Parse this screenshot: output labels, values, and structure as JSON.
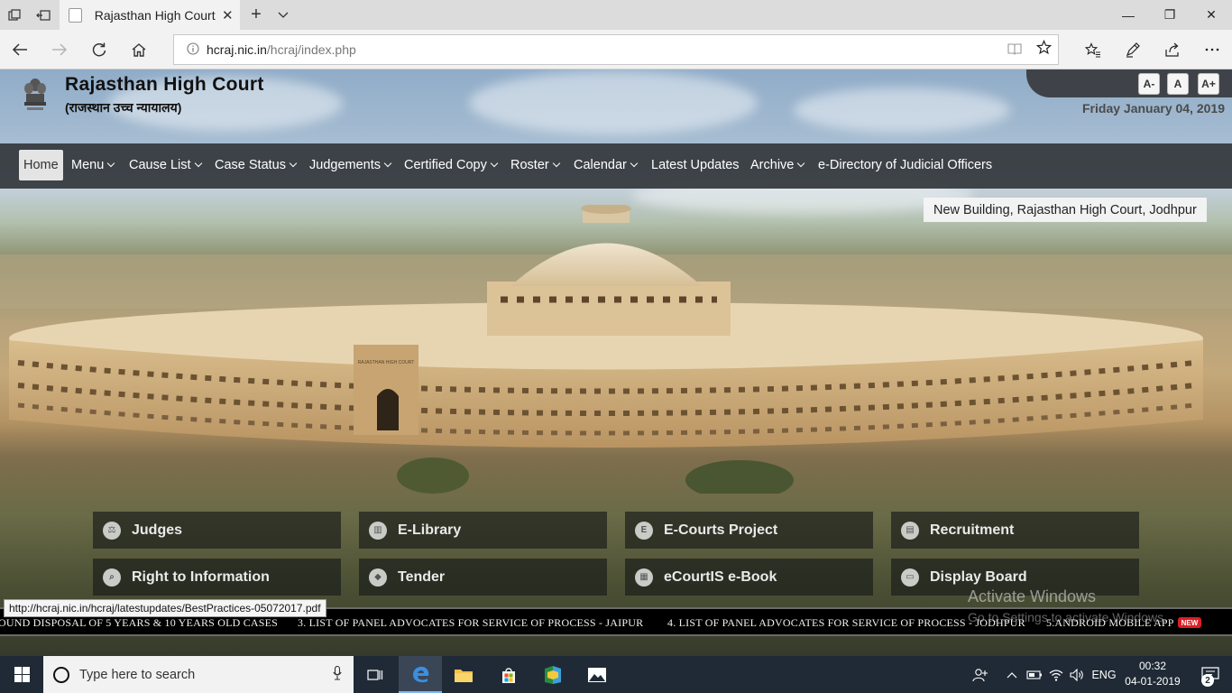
{
  "browser": {
    "tab_title": "Rajasthan High Court",
    "tab_close": "✕",
    "new_tab": "+",
    "url_domain": "hcraj.nic.in",
    "url_path": "/hcraj/index.php",
    "window_min": "—",
    "window_restore": "❐",
    "window_close": "✕"
  },
  "site": {
    "title": "Rajasthan High Court",
    "subtitle": "(राजस्थान उच्च न्यायालय)",
    "date": "Friday January 04, 2019",
    "font_sizes": [
      "A-",
      "A",
      "A+"
    ]
  },
  "nav": {
    "items": [
      {
        "label": "Home",
        "dropdown": false,
        "active": true
      },
      {
        "label": "Menu",
        "dropdown": true,
        "active": false
      },
      {
        "label": "Cause List",
        "dropdown": true,
        "active": false
      },
      {
        "label": "Case Status",
        "dropdown": true,
        "active": false
      },
      {
        "label": "Judgements",
        "dropdown": true,
        "active": false
      },
      {
        "label": "Certified Copy",
        "dropdown": true,
        "active": false
      },
      {
        "label": "Roster",
        "dropdown": true,
        "active": false
      },
      {
        "label": "Calendar",
        "dropdown": true,
        "active": false
      },
      {
        "label": "Latest Updates",
        "dropdown": false,
        "active": false
      },
      {
        "label": "Archive",
        "dropdown": true,
        "active": false
      },
      {
        "label": "e-Directory of Judicial Officers",
        "dropdown": false,
        "active": false
      }
    ]
  },
  "banner": {
    "caption": "New Building, Rajasthan High Court, Jodhpur",
    "building_sign": "RAJASTHAN HIGH COURT"
  },
  "quick_links": [
    {
      "label": "Judges",
      "icon": "gavel-icon",
      "glyph": "⚖"
    },
    {
      "label": "E-Library",
      "icon": "library-icon",
      "glyph": "▥"
    },
    {
      "label": "E-Courts Project",
      "icon": "ecourts-icon",
      "glyph": "E"
    },
    {
      "label": "Recruitment",
      "icon": "recruitment-icon",
      "glyph": "▤"
    },
    {
      "label": "Right to Information",
      "icon": "rti-search-icon",
      "glyph": "⌕"
    },
    {
      "label": "Tender",
      "icon": "tender-icon",
      "glyph": "◆"
    },
    {
      "label": "eCourtIS e-Book",
      "icon": "ebook-icon",
      "glyph": "▦"
    },
    {
      "label": "Display Board",
      "icon": "display-board-icon",
      "glyph": "▭"
    }
  ],
  "status_url": "http://hcraj.nic.in/hcraj/latestupdates/BestPractices-05072017.pdf",
  "ticker": {
    "items": [
      "OUND DISPOSAL OF 5 YEARS & 10 YEARS OLD CASES",
      "3. LIST OF PANEL ADVOCATES FOR SERVICE OF PROCESS - JAIPUR",
      "4. LIST OF PANEL ADVOCATES FOR SERVICE OF PROCESS - JODHPUR",
      "5.ANDROID MOBILE APP"
    ],
    "badge": "NEW"
  },
  "watermark": {
    "title": "Activate Windows",
    "subtitle": "Go to Settings to activate Windows."
  },
  "taskbar": {
    "search_placeholder": "Type here to search",
    "language": "ENG",
    "time": "00:32",
    "date": "04-01-2019",
    "notifications": "2"
  }
}
